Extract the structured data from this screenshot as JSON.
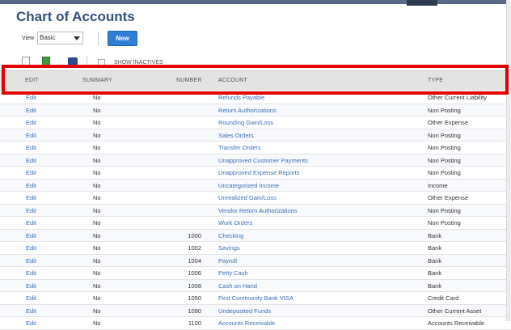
{
  "page": {
    "title": "Chart of Accounts"
  },
  "view": {
    "label": "View",
    "selected": "Basic"
  },
  "actions": {
    "new_label": "New"
  },
  "toolbar": {
    "show_inactives_label": "SHOW INACTIVES"
  },
  "table": {
    "headers": {
      "edit": "EDIT",
      "summary": "SUMMARY",
      "number": "NUMBER",
      "account": "ACCOUNT",
      "type": "TYPE"
    },
    "rows": [
      {
        "edit": "Edit",
        "summary": "No",
        "number": "",
        "account": "Refunds Payable",
        "type": "Other Current Liability"
      },
      {
        "edit": "Edit",
        "summary": "No",
        "number": "",
        "account": "Return Authorizations",
        "type": "Non Posting"
      },
      {
        "edit": "Edit",
        "summary": "No",
        "number": "",
        "account": "Rounding Gain/Loss",
        "type": "Other Expense"
      },
      {
        "edit": "Edit",
        "summary": "No",
        "number": "",
        "account": "Sales Orders",
        "type": "Non Posting"
      },
      {
        "edit": "Edit",
        "summary": "No",
        "number": "",
        "account": "Transfer Orders",
        "type": "Non Posting"
      },
      {
        "edit": "Edit",
        "summary": "No",
        "number": "",
        "account": "Unapproved Customer Payments",
        "type": "Non Posting"
      },
      {
        "edit": "Edit",
        "summary": "No",
        "number": "",
        "account": "Unapproved Expense Reports",
        "type": "Non Posting"
      },
      {
        "edit": "Edit",
        "summary": "No",
        "number": "",
        "account": "Uncategorized Income",
        "type": "Income"
      },
      {
        "edit": "Edit",
        "summary": "No",
        "number": "",
        "account": "Unrealized Gain/Loss",
        "type": "Other Expense"
      },
      {
        "edit": "Edit",
        "summary": "No",
        "number": "",
        "account": "Vendor Return Authorizations",
        "type": "Non Posting"
      },
      {
        "edit": "Edit",
        "summary": "No",
        "number": "",
        "account": "Work Orders",
        "type": "Non Posting"
      },
      {
        "edit": "Edit",
        "summary": "No",
        "number": "1000",
        "account": "Checking",
        "type": "Bank"
      },
      {
        "edit": "Edit",
        "summary": "No",
        "number": "1002",
        "account": "Savings",
        "type": "Bank"
      },
      {
        "edit": "Edit",
        "summary": "No",
        "number": "1004",
        "account": "Payroll",
        "type": "Bank"
      },
      {
        "edit": "Edit",
        "summary": "No",
        "number": "1006",
        "account": "Petty Cash",
        "type": "Bank"
      },
      {
        "edit": "Edit",
        "summary": "No",
        "number": "1008",
        "account": "Cash on Hand",
        "type": "Bank"
      },
      {
        "edit": "Edit",
        "summary": "No",
        "number": "1050",
        "account": "First Community Bank VISA",
        "type": "Credit Card"
      },
      {
        "edit": "Edit",
        "summary": "No",
        "number": "1090",
        "account": "Undeposited Funds",
        "type": "Other Current Asset"
      },
      {
        "edit": "Edit",
        "summary": "No",
        "number": "1100",
        "account": "Accounts Receivable",
        "type": "Accounts Receivable"
      }
    ]
  },
  "icons": {
    "new_doc": "new-document-icon",
    "export": "excel-export-icon",
    "print": "print-icon",
    "dropdown": "chevron-down-icon"
  },
  "colors": {
    "title": "#35507a",
    "link": "#3b6fb5",
    "new_button": "#2e7ed6",
    "highlight": "#e00000",
    "header_bg": "#e3e3e3"
  }
}
